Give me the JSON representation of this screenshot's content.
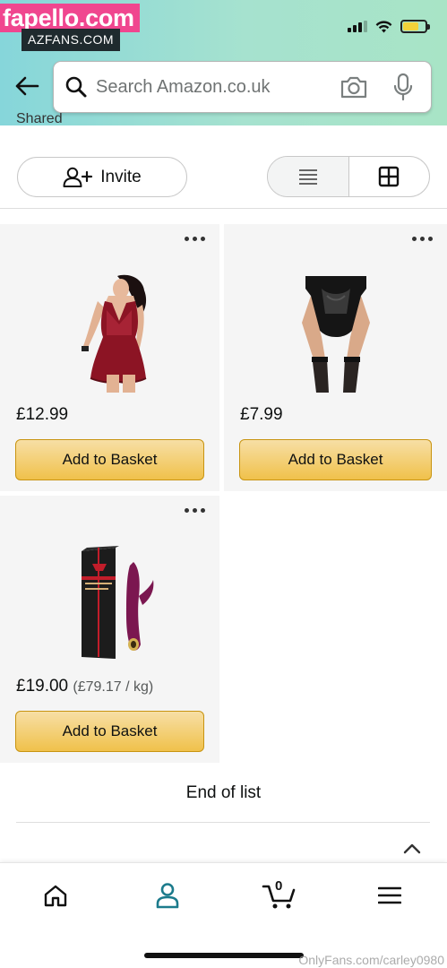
{
  "watermarks": {
    "fapello": "fapello.com",
    "azfans": "AZFANS.COM",
    "onlyfans": "OnlyFans.com/carley0980"
  },
  "search": {
    "placeholder": "Search Amazon.co.uk"
  },
  "list_header": {
    "shared_label": "Shared"
  },
  "toolbar": {
    "invite_label": "Invite",
    "view_modes": [
      "list-view-icon",
      "grid-view-icon"
    ],
    "selected_view": "grid"
  },
  "products": [
    {
      "name": "red-lace-babydoll",
      "price": "£12.99",
      "unit_price": "",
      "button_label": "Add to Basket"
    },
    {
      "name": "black-lace-suspender-set",
      "price": "£7.99",
      "unit_price": "",
      "button_label": "Add to Basket"
    },
    {
      "name": "massager-product",
      "price": "£19.00",
      "unit_price": "(£79.17 / kg)",
      "button_label": "Add to Basket"
    }
  ],
  "end_of_list": "End of list",
  "bottom_nav": {
    "items": [
      "home-icon",
      "account-icon",
      "cart-icon",
      "menu-icon"
    ],
    "cart_count": "0",
    "active": "account-icon"
  },
  "colors": {
    "header_gradient_start": "#86d6da",
    "header_gradient_end": "#a8e4c6",
    "button_yellow": "#f0c14b",
    "active_nav": "#1c7b8c"
  }
}
